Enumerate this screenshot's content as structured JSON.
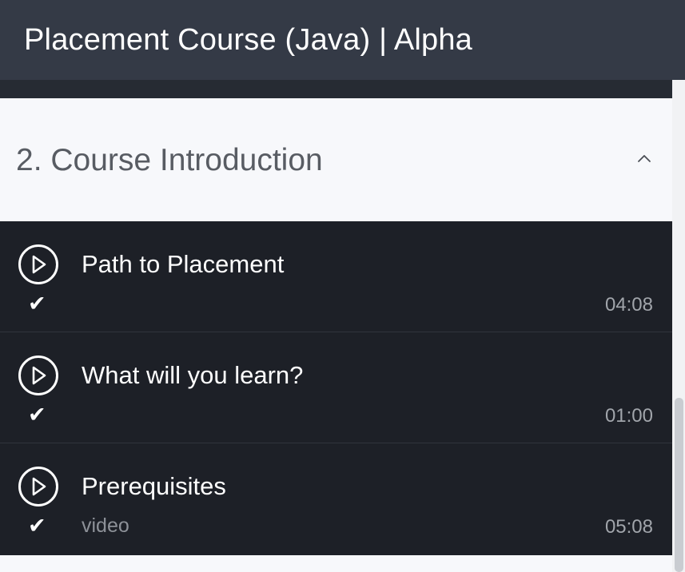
{
  "header": {
    "title": "Placement Course (Java) | Alpha"
  },
  "section": {
    "title": "2. Course Introduction",
    "expanded": true,
    "toggle_icon": "chevron-up-icon"
  },
  "lectures": [
    {
      "title": "Path to Placement",
      "type": "",
      "duration": "04:08",
      "completed": true,
      "icon": "play-circle-icon"
    },
    {
      "title": "What will you learn?",
      "type": "",
      "duration": "01:00",
      "completed": true,
      "icon": "play-circle-icon"
    },
    {
      "title": "Prerequisites",
      "type": "video",
      "duration": "05:08",
      "completed": true,
      "icon": "play-circle-icon"
    }
  ],
  "glyphs": {
    "check": "✔"
  },
  "colors": {
    "header_bg": "#343a46",
    "lecture_bg": "#1d2027",
    "section_bg": "#f7f8fb",
    "section_text": "#585c63",
    "duration_text": "#a1a5ab"
  }
}
